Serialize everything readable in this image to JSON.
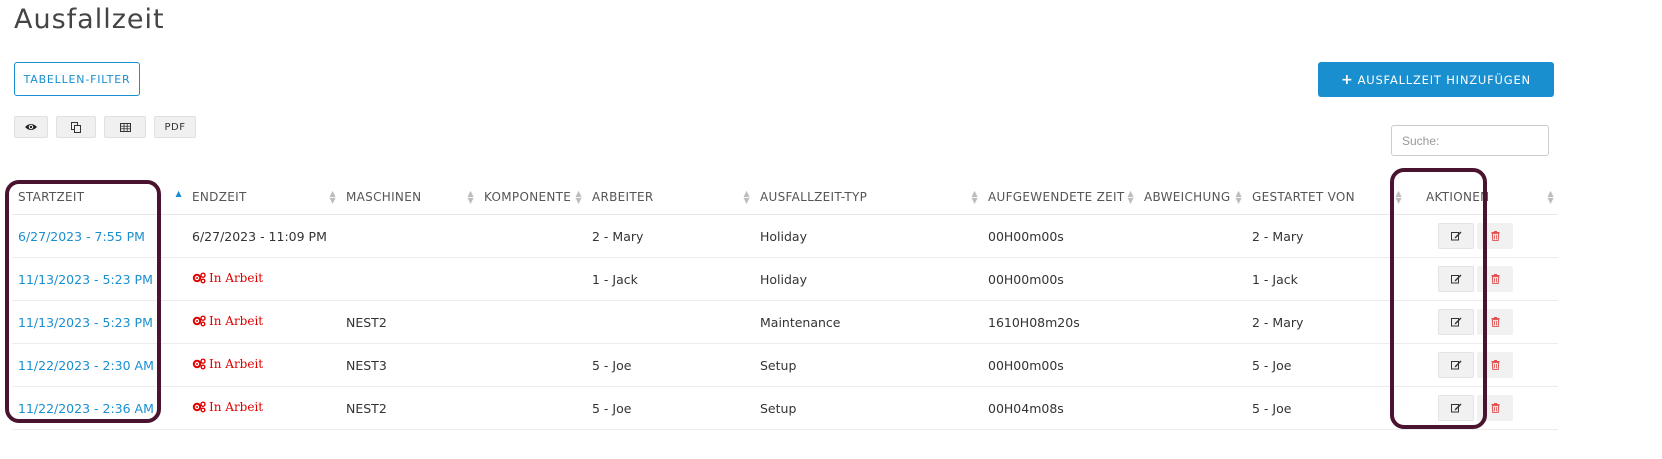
{
  "page": {
    "title": "Ausfallzeit"
  },
  "toolbar": {
    "filter_label": "TABELLEN-FILTER",
    "add_label": "AUSFALLZEIT HINZUFÜGEN",
    "add_icon": "plus-icon",
    "export": [
      {
        "name": "view-columns-button",
        "icon": "eye-icon",
        "label": ""
      },
      {
        "name": "copy-button",
        "icon": "copy-icon",
        "label": ""
      },
      {
        "name": "excel-button",
        "icon": "table-icon",
        "label": ""
      },
      {
        "name": "pdf-button",
        "icon": "",
        "label": "PDF"
      }
    ]
  },
  "search": {
    "placeholder": "Suche:",
    "value": ""
  },
  "table": {
    "columns": [
      {
        "label": "STARTZEIT",
        "sort": "asc"
      },
      {
        "label": "ENDZEIT",
        "sort": "none"
      },
      {
        "label": "MASCHINEN",
        "sort": "none"
      },
      {
        "label": "KOMPONENTE",
        "sort": "none"
      },
      {
        "label": "ARBEITER",
        "sort": "none"
      },
      {
        "label": "AUSFALLZEIT-TYP",
        "sort": "none"
      },
      {
        "label": "AUFGEWENDETE ZEIT",
        "sort": "none"
      },
      {
        "label": "ABWEICHUNG",
        "sort": "none"
      },
      {
        "label": "GESTARTET VON",
        "sort": "none"
      },
      {
        "label": "AKTIONEN",
        "sort": "none"
      }
    ],
    "in_work_label": "In Arbeit",
    "rows": [
      {
        "start": "6/27/2023 - 7:55 PM",
        "end": "6/27/2023 - 11:09 PM",
        "in_work": false,
        "machine": "",
        "component": "",
        "worker": "2 - Mary",
        "type": "Holiday",
        "spent": "00H00m00s",
        "deviation": "",
        "started_by": "2 - Mary"
      },
      {
        "start": "11/13/2023 - 5:23 PM",
        "end": "",
        "in_work": true,
        "machine": "",
        "component": "",
        "worker": "1 - Jack",
        "type": "Holiday",
        "spent": "00H00m00s",
        "deviation": "",
        "started_by": "1 - Jack"
      },
      {
        "start": "11/13/2023 - 5:23 PM",
        "end": "",
        "in_work": true,
        "machine": "NEST2",
        "component": "",
        "worker": "",
        "type": "Maintenance",
        "spent": "1610H08m20s",
        "deviation": "",
        "started_by": "2 - Mary"
      },
      {
        "start": "11/22/2023 - 2:30 AM",
        "end": "",
        "in_work": true,
        "machine": "NEST3",
        "component": "",
        "worker": "5 - Joe",
        "type": "Setup",
        "spent": "00H00m00s",
        "deviation": "",
        "started_by": "5 - Joe"
      },
      {
        "start": "11/22/2023 - 2:36 AM",
        "end": "",
        "in_work": true,
        "machine": "NEST2",
        "component": "",
        "worker": "5 - Joe",
        "type": "Setup",
        "spent": "00H04m08s",
        "deviation": "",
        "started_by": "5 - Joe"
      }
    ],
    "row_actions": {
      "edit_icon": "edit-icon",
      "delete_icon": "trash-icon"
    }
  },
  "colors": {
    "accent": "#1a8fd0",
    "in_work": "#e00000",
    "highlight": "#4a1430"
  }
}
